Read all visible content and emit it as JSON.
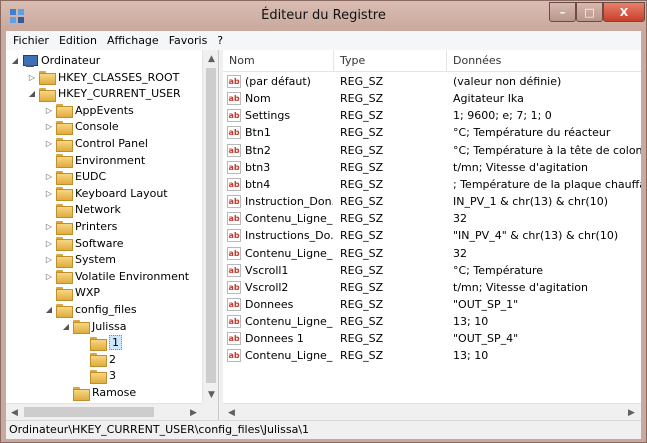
{
  "window": {
    "title": "Éditeur du Registre",
    "minimize_glyph": "–",
    "maximize_glyph": "□",
    "close_glyph": "X"
  },
  "menu": [
    "Fichier",
    "Edition",
    "Affichage",
    "Favoris",
    "?"
  ],
  "tree": [
    {
      "label": "Ordinateur",
      "level": 0,
      "expander": "◢",
      "icon": "computer-icon"
    },
    {
      "label": "HKEY_CLASSES_ROOT",
      "level": 1,
      "expander": "▷",
      "icon": "folder-icon"
    },
    {
      "label": "HKEY_CURRENT_USER",
      "level": 1,
      "expander": "◢",
      "icon": "folder-icon"
    },
    {
      "label": "AppEvents",
      "level": 2,
      "expander": "▷",
      "icon": "folder-icon"
    },
    {
      "label": "Console",
      "level": 2,
      "expander": "▷",
      "icon": "folder-icon"
    },
    {
      "label": "Control Panel",
      "level": 2,
      "expander": "▷",
      "icon": "folder-icon"
    },
    {
      "label": "Environment",
      "level": 2,
      "expander": "",
      "icon": "folder-icon"
    },
    {
      "label": "EUDC",
      "level": 2,
      "expander": "▷",
      "icon": "folder-icon"
    },
    {
      "label": "Keyboard Layout",
      "level": 2,
      "expander": "▷",
      "icon": "folder-icon"
    },
    {
      "label": "Network",
      "level": 2,
      "expander": "",
      "icon": "folder-icon"
    },
    {
      "label": "Printers",
      "level": 2,
      "expander": "▷",
      "icon": "folder-icon"
    },
    {
      "label": "Software",
      "level": 2,
      "expander": "▷",
      "icon": "folder-icon"
    },
    {
      "label": "System",
      "level": 2,
      "expander": "▷",
      "icon": "folder-icon"
    },
    {
      "label": "Volatile Environment",
      "level": 2,
      "expander": "▷",
      "icon": "folder-icon"
    },
    {
      "label": "WXP",
      "level": 2,
      "expander": "",
      "icon": "folder-icon"
    },
    {
      "label": "config_files",
      "level": 2,
      "expander": "◢",
      "icon": "folder-icon"
    },
    {
      "label": "Julissa",
      "level": 3,
      "expander": "◢",
      "icon": "folder-icon"
    },
    {
      "label": "1",
      "level": 4,
      "expander": "",
      "icon": "folder-icon",
      "selected": true
    },
    {
      "label": "2",
      "level": 4,
      "expander": "",
      "icon": "folder-icon"
    },
    {
      "label": "3",
      "level": 4,
      "expander": "",
      "icon": "folder-icon"
    },
    {
      "label": "Ramose",
      "level": 3,
      "expander": "",
      "icon": "folder-icon"
    }
  ],
  "columns": {
    "name": "Nom",
    "type": "Type",
    "data": "Données"
  },
  "values": [
    {
      "name": "(par défaut)",
      "type": "REG_SZ",
      "data": "(valeur non définie)"
    },
    {
      "name": "Nom",
      "type": "REG_SZ",
      "data": "Agitateur Ika"
    },
    {
      "name": "Settings",
      "type": "REG_SZ",
      "data": "1; 9600; e; 7; 1; 0"
    },
    {
      "name": "Btn1",
      "type": "REG_SZ",
      "data": "°C; Température du réacteur"
    },
    {
      "name": "Btn2",
      "type": "REG_SZ",
      "data": "°C; Température à la tête de colonne"
    },
    {
      "name": "btn3",
      "type": "REG_SZ",
      "data": "t/mn; Vitesse d'agitation"
    },
    {
      "name": "btn4",
      "type": "REG_SZ",
      "data": "   ; Température de la plaque chauffante"
    },
    {
      "name": "Instruction_Don...",
      "type": "REG_SZ",
      "data": "IN_PV_1 & chr(13) & chr(10)"
    },
    {
      "name": "Contenu_Ligne_...",
      "type": "REG_SZ",
      "data": "32"
    },
    {
      "name": "Instructions_Do...",
      "type": "REG_SZ",
      "data": "\"IN_PV_4\" & chr(13) & chr(10)"
    },
    {
      "name": "Contenu_Ligne_...",
      "type": "REG_SZ",
      "data": "32"
    },
    {
      "name": "Vscroll1",
      "type": "REG_SZ",
      "data": "°C; Température"
    },
    {
      "name": "Vscroll2",
      "type": "REG_SZ",
      "data": "t/mn; Vitesse d'agitation"
    },
    {
      "name": "Donnees",
      "type": "REG_SZ",
      "data": "\"OUT_SP_1\""
    },
    {
      "name": "Contenu_Ligne_...",
      "type": "REG_SZ",
      "data": "13; 10"
    },
    {
      "name": "Donnees 1",
      "type": "REG_SZ",
      "data": "\"OUT_SP_4\""
    },
    {
      "name": "Contenu_Ligne_...",
      "type": "REG_SZ",
      "data": "13; 10"
    }
  ],
  "value_icon": "ab",
  "status": "Ordinateur\\HKEY_CURRENT_USER\\config_files\\Julissa\\1",
  "colors": {
    "frame": "#c9a89d",
    "close": "#c6402b",
    "selection": "#cde8ff"
  }
}
